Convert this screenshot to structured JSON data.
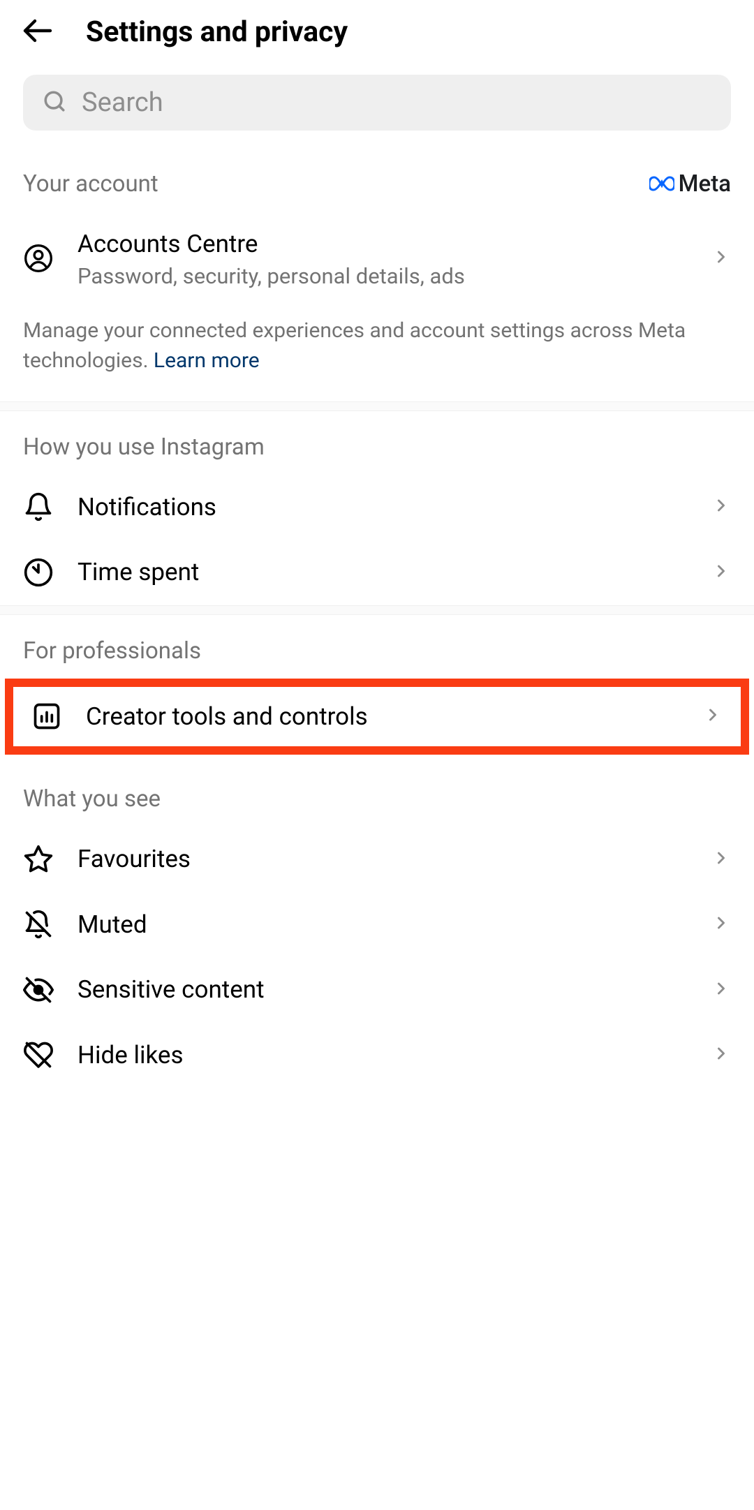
{
  "header": {
    "title": "Settings and privacy"
  },
  "search": {
    "placeholder": "Search"
  },
  "sections": {
    "yourAccount": {
      "title": "Your account",
      "metaLabel": "Meta",
      "accountsCentre": {
        "title": "Accounts Centre",
        "subtitle": "Password, security, personal details, ads"
      },
      "infoText": "Manage your connected experiences and account settings across Meta technologies. ",
      "learnMore": "Learn more"
    },
    "howYouUse": {
      "title": "How you use Instagram",
      "notifications": "Notifications",
      "timeSpent": "Time spent"
    },
    "forProfessionals": {
      "title": "For professionals",
      "creatorTools": "Creator tools and controls"
    },
    "whatYouSee": {
      "title": "What you see",
      "favourites": "Favourites",
      "muted": "Muted",
      "sensitiveContent": "Sensitive content",
      "hideLikes": "Hide likes"
    }
  }
}
